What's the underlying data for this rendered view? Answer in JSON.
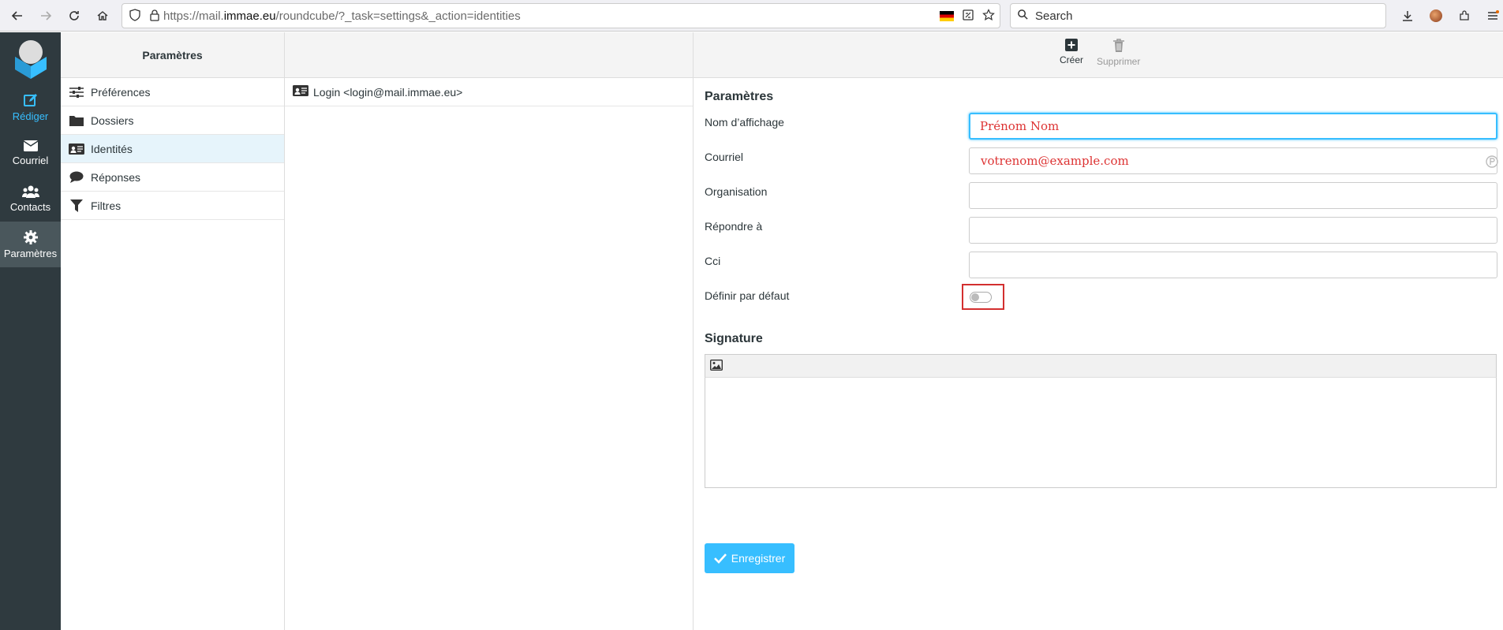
{
  "browser": {
    "url_prefix": "https://mail.",
    "url_domain": "immae.eu",
    "url_suffix": "/roundcube/?_task=settings&_action=identities",
    "search_placeholder": "Search"
  },
  "taskmenu": {
    "compose": "Rédiger",
    "mail": "Courriel",
    "contacts": "Contacts",
    "settings": "Paramètres"
  },
  "settings_nav": {
    "title": "Paramètres",
    "items": [
      {
        "label": "Préférences",
        "icon": "sliders-icon"
      },
      {
        "label": "Dossiers",
        "icon": "folder-icon"
      },
      {
        "label": "Identités",
        "icon": "id-card-icon"
      },
      {
        "label": "Réponses",
        "icon": "comment-icon"
      },
      {
        "label": "Filtres",
        "icon": "filter-icon"
      }
    ]
  },
  "identities": {
    "items": [
      "Login <login@mail.immae.eu>"
    ]
  },
  "toolbar": {
    "create": "Créer",
    "delete": "Supprimer"
  },
  "form": {
    "section_title": "Paramètres",
    "display_name_label": "Nom d’affichage",
    "display_name_placeholder": "Prénom Nom",
    "email_label": "Courriel",
    "email_placeholder": "votrenom@example.com",
    "organization_label": "Organisation",
    "reply_to_label": "Répondre à",
    "bcc_label": "Cci",
    "default_label": "Définir par défaut",
    "default_on": false,
    "signature_title": "Signature",
    "save_label": "Enregistrer"
  },
  "colors": {
    "accent": "#37beff",
    "sidebar": "#2f3a3f",
    "placeholder": "#d33333"
  }
}
